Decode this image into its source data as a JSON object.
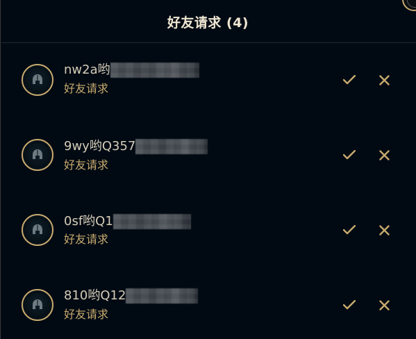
{
  "header": {
    "title": "好友请求 (4)"
  },
  "colors": {
    "background": "#010a13",
    "gold": "#c8aa6e",
    "title_text": "#f0e6d2",
    "name_text": "#d5ccb8"
  },
  "requests": [
    {
      "name": "nw2a哟",
      "status": "好友请求",
      "accept_icon": "check-icon",
      "decline_icon": "close-icon"
    },
    {
      "name": "9wy哟Q357",
      "status": "好友请求",
      "accept_icon": "check-icon",
      "decline_icon": "close-icon"
    },
    {
      "name": "0sf哟Q1",
      "status": "好友请求",
      "accept_icon": "check-icon",
      "decline_icon": "close-icon"
    },
    {
      "name": "810哟Q12",
      "status": "好友请求",
      "accept_icon": "check-icon",
      "decline_icon": "close-icon"
    }
  ]
}
